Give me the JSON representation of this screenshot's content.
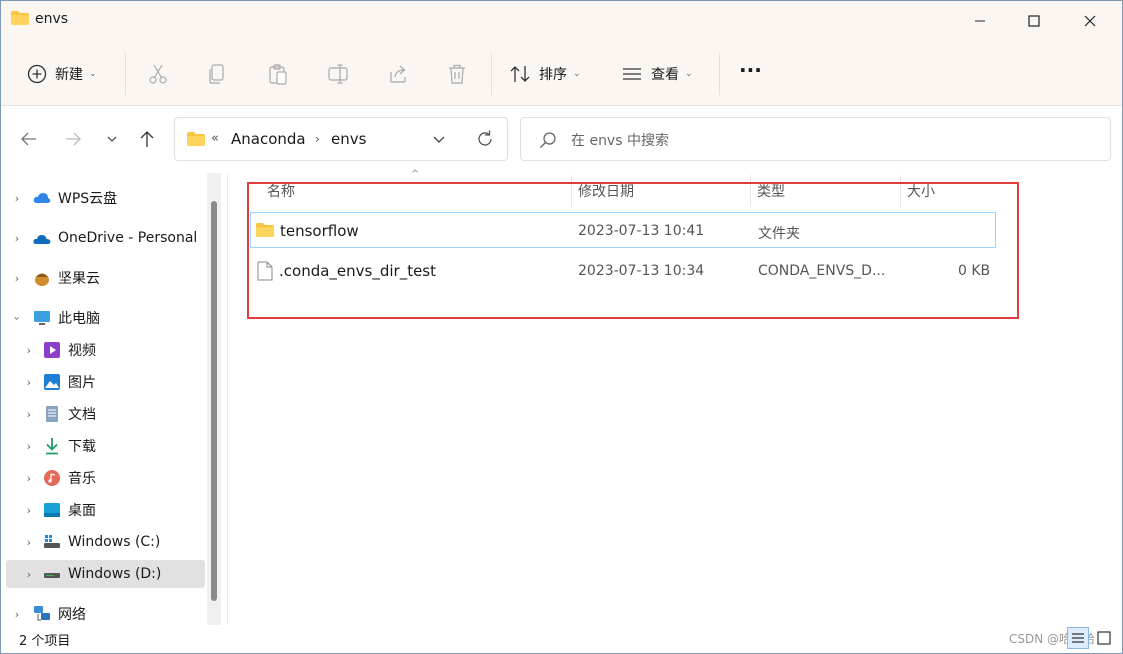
{
  "window": {
    "title": "envs",
    "folder_icon_color": "#f7c541"
  },
  "toolbar": {
    "new_label": "新建",
    "sort_label": "排序",
    "view_label": "查看",
    "more_label": "···",
    "tools": [
      "cut-icon",
      "copy-icon",
      "paste-icon",
      "rename-icon",
      "share-icon",
      "delete-icon"
    ]
  },
  "address": {
    "overflow": "«",
    "crumbs": [
      "Anaconda",
      "envs"
    ],
    "search_placeholder": "在 envs 中搜索"
  },
  "sidebar": {
    "items": [
      {
        "label": "WPS云盘",
        "icon": "wps-cloud-icon"
      },
      {
        "label": "OneDrive - Personal",
        "icon": "onedrive-icon"
      },
      {
        "label": "坚果云",
        "icon": "nutstore-icon"
      },
      {
        "label": "此电脑",
        "icon": "this-pc-icon"
      },
      {
        "label": "视频",
        "icon": "videos-icon"
      },
      {
        "label": "图片",
        "icon": "pictures-icon"
      },
      {
        "label": "文档",
        "icon": "documents-icon"
      },
      {
        "label": "下载",
        "icon": "downloads-icon"
      },
      {
        "label": "音乐",
        "icon": "music-icon"
      },
      {
        "label": "桌面",
        "icon": "desktop-icon"
      },
      {
        "label": "Windows (C:)",
        "icon": "drive-c-icon"
      },
      {
        "label": "Windows (D:)",
        "icon": "drive-d-icon"
      },
      {
        "label": "网络",
        "icon": "network-icon"
      }
    ]
  },
  "file_list": {
    "columns": [
      "名称",
      "修改日期",
      "类型",
      "大小"
    ],
    "rows": [
      {
        "name": "tensorflow",
        "modified": "2023-07-13 10:41",
        "type": "文件夹",
        "size": "",
        "icon": "folder-icon"
      },
      {
        "name": ".conda_envs_dir_test",
        "modified": "2023-07-13 10:34",
        "type": "CONDA_ENVS_D...",
        "size": "0 KB",
        "icon": "file-icon"
      }
    ]
  },
  "status": {
    "count": "2 个项目",
    "watermark": "CSDN @哈哈哈"
  },
  "colors": {
    "highlight_border": "#e23b3b",
    "selection_border": "#99d1ff",
    "chrome_bg": "#fbf6f2"
  }
}
